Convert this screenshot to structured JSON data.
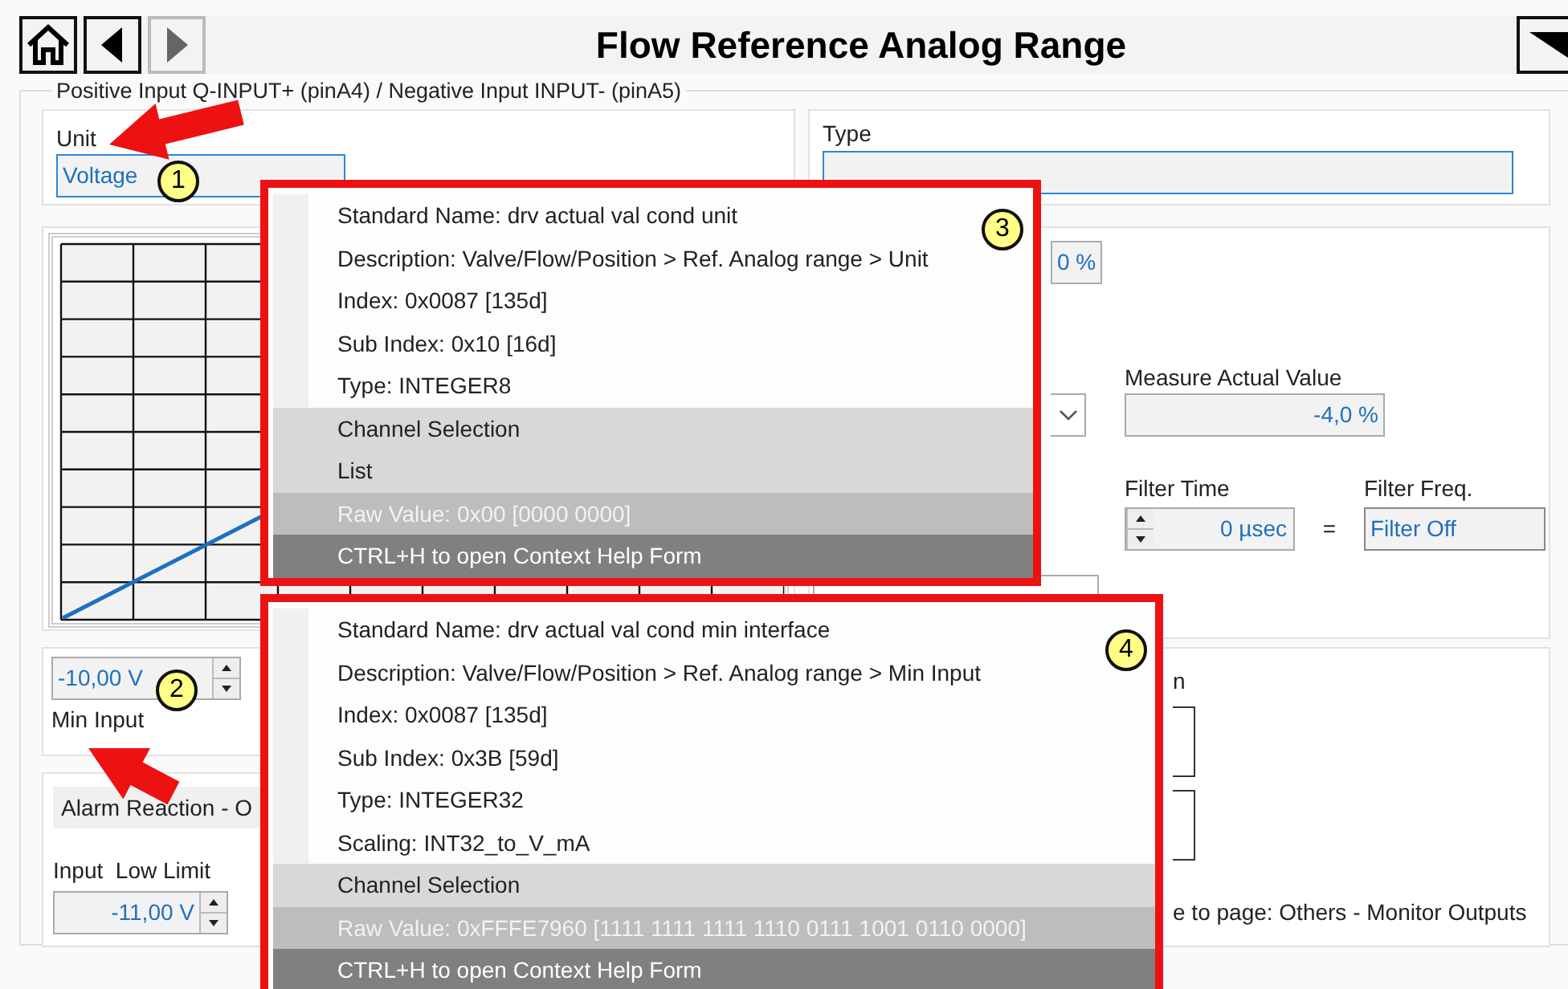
{
  "header": {
    "title": "Flow Reference Analog Range"
  },
  "group": {
    "legend": "Positive Input Q-INPUT+ (pinA4) / Negative Input INPUT- (pinA5)"
  },
  "unit": {
    "label": "Unit",
    "value": "Voltage"
  },
  "type": {
    "label": "Type"
  },
  "reference": {
    "value": "0 %"
  },
  "measure": {
    "label": "Measure Actual Value",
    "value": "-4,0 %"
  },
  "filter_time": {
    "label": "Filter Time",
    "value": "0 µsec"
  },
  "equals": "=",
  "filter_freq": {
    "label": "Filter Freq.",
    "value": "Filter Off"
  },
  "min_input": {
    "value": "-10,00 V",
    "label": "Min Input"
  },
  "alarm": {
    "title": "Alarm Reaction - O",
    "low_limit_label": "Input  Low Limit",
    "low_limit_value": "-11,00 V"
  },
  "monitor": {
    "label": "n",
    "note": "e to page: Others - Monitor Outputs"
  },
  "callouts": [
    "1",
    "2"
  ],
  "tooltips": [
    {
      "badge": "3",
      "lines": [
        {
          "kind": "info",
          "text": "Standard Name: drv actual val cond unit"
        },
        {
          "kind": "info",
          "text": "Description: Valve/Flow/Position > Ref. Analog range > Unit"
        },
        {
          "kind": "info",
          "text": "Index: 0x0087 [135d]"
        },
        {
          "kind": "info",
          "text": "Sub Index: 0x10 [16d]"
        },
        {
          "kind": "info",
          "text": "Type: INTEGER8"
        },
        {
          "kind": "item",
          "text": "Channel Selection"
        },
        {
          "kind": "item",
          "text": "List"
        },
        {
          "kind": "raw",
          "text": "Raw Value: 0x00 [0000 0000]"
        },
        {
          "kind": "hint",
          "text": "CTRL+H to open Context Help Form"
        }
      ]
    },
    {
      "badge": "4",
      "lines": [
        {
          "kind": "info",
          "text": "Standard Name: drv actual val cond min interface"
        },
        {
          "kind": "info",
          "text": "Description: Valve/Flow/Position > Ref. Analog range > Min Input"
        },
        {
          "kind": "info",
          "text": "Index: 0x0087 [135d]"
        },
        {
          "kind": "info",
          "text": "Sub Index: 0x3B [59d]"
        },
        {
          "kind": "info",
          "text": "Type: INTEGER32"
        },
        {
          "kind": "info",
          "text": "Scaling: INT32_to_V_mA"
        },
        {
          "kind": "item",
          "text": "Channel Selection"
        },
        {
          "kind": "raw",
          "text": "Raw Value: 0xFFFE7960 [1111 1111 1111 1110 0111 1001 0110 0000]"
        },
        {
          "kind": "hint",
          "text": "CTRL+H to open Context Help Form"
        }
      ]
    }
  ]
}
